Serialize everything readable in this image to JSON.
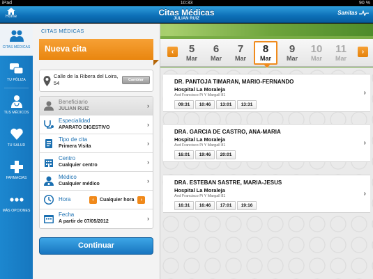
{
  "status_bar": {
    "left": "iPad",
    "time": "10:33",
    "battery": "90 %"
  },
  "header": {
    "home_label": "Home",
    "title": "Citas Médicas",
    "subtitle": "JULIAN RUIZ",
    "brand": "Sanitas",
    "colors": {
      "header": "#0d6fb7",
      "accent": "#f08b1c"
    }
  },
  "tabbar": {
    "items": [
      {
        "label": "CITAS MÉDICAS",
        "icon": "people-icon",
        "active": true
      },
      {
        "label": "TU PÓLIZA",
        "icon": "chat-bubbles-icon",
        "active": false
      },
      {
        "label": "TUS MÉDICOS",
        "icon": "doctors-icon",
        "active": false
      },
      {
        "label": "TU SALUD",
        "icon": "heart-icon",
        "active": false
      },
      {
        "label": "FARMACIAS",
        "icon": "cross-icon",
        "active": false
      },
      {
        "label": "MÁS OPCIONES",
        "icon": "more-icon",
        "active": false
      }
    ]
  },
  "form": {
    "section_title": "CITAS MÉDICAS",
    "heading": "Nueva cita",
    "address": "Calle de la Ribera del Loira, 54",
    "change_label": "Cambiar",
    "rows": [
      {
        "key": "Beneficiario",
        "value": "JULIAN RUIZ",
        "icon": "person-icon"
      },
      {
        "key": "Especialidad",
        "value": "APARATO DIGESTIVO",
        "icon": "stethoscope-icon"
      },
      {
        "key": "Tipo de cita",
        "value": "Primera Visita",
        "icon": "clipboard-icon"
      },
      {
        "key": "Centro",
        "value": "Cualquier centro",
        "icon": "building-icon"
      },
      {
        "key": "Médico",
        "value": "Cualquier médico",
        "icon": "doctor-icon"
      },
      {
        "key": "Hora",
        "value": "Cualquier hora",
        "icon": "clock-icon"
      },
      {
        "key": "Fecha",
        "value": "A partir de 07/05/2012",
        "icon": "calendar-icon"
      }
    ],
    "continue_label": "Continuar"
  },
  "dates": {
    "prev": "‹",
    "next": "›",
    "days": [
      {
        "num": "5",
        "month": "Mar"
      },
      {
        "num": "6",
        "month": "Mar"
      },
      {
        "num": "7",
        "month": "Mar"
      },
      {
        "num": "8",
        "month": "Mar"
      },
      {
        "num": "9",
        "month": "Mar"
      },
      {
        "num": "10",
        "month": "Mar"
      },
      {
        "num": "11",
        "month": "Mar"
      }
    ],
    "selected": "8"
  },
  "results": [
    {
      "doctor": "DR. PANTOJA TIMARAN, MARIO-FERNANDO",
      "hospital": "Hospital La Moraleja",
      "address": "Avd Francisco Pi Y Margall 81",
      "slots": [
        "09:31",
        "10:46",
        "13:01",
        "13:31"
      ]
    },
    {
      "doctor": "DRA. GARCIA DE CASTRO, ANA-MARIA",
      "hospital": "Hospital La Moraleja",
      "address": "Avd Francisco Pi Y Margall 81",
      "slots": [
        "16:01",
        "19:46",
        "20:01"
      ]
    },
    {
      "doctor": "DRA. ESTEBAN SASTRE, MARIA-JESUS",
      "hospital": "Hospital La Moraleja",
      "address": "Avd Francisco Pi Y Margall 81",
      "slots": [
        "16:31",
        "16:46",
        "17:01",
        "19:16"
      ]
    }
  ]
}
